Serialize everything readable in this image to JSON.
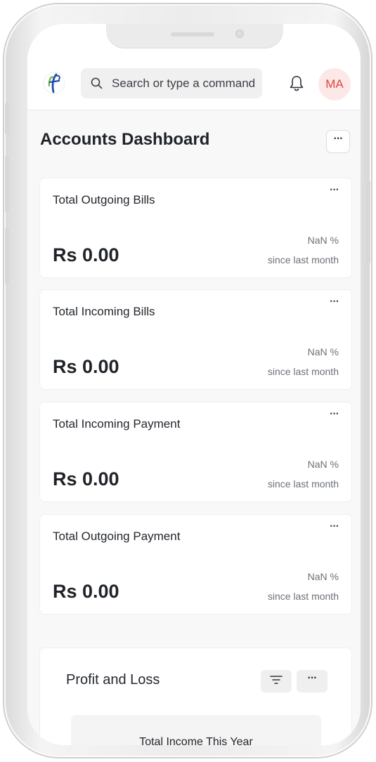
{
  "header": {
    "search_placeholder": "Search or type a command",
    "avatar_initials": "MA",
    "logo_icon": "hf-logo",
    "search_icon": "search-icon",
    "notification_icon": "bell-icon"
  },
  "page": {
    "title": "Accounts Dashboard",
    "menu_label": "···"
  },
  "cards": [
    {
      "title": "Total Outgoing Bills",
      "value": "Rs 0.00",
      "change": "NaN %",
      "since": "since last month",
      "menu": "···"
    },
    {
      "title": "Total Incoming Bills",
      "value": "Rs 0.00",
      "change": "NaN %",
      "since": "since last month",
      "menu": "···"
    },
    {
      "title": "Total Incoming Payment",
      "value": "Rs 0.00",
      "change": "NaN %",
      "since": "since last month",
      "menu": "···"
    },
    {
      "title": "Total Outgoing Payment",
      "value": "Rs 0.00",
      "change": "NaN %",
      "since": "since last month",
      "menu": "···"
    }
  ],
  "profit_loss": {
    "title": "Profit and Loss",
    "menu_label": "···",
    "income_label": "Total Income This Year"
  },
  "colors": {
    "avatar_bg": "#fde8e8",
    "avatar_text": "#e0443e",
    "logo_blue": "#1e4fb0",
    "logo_green": "#6cb33e"
  }
}
